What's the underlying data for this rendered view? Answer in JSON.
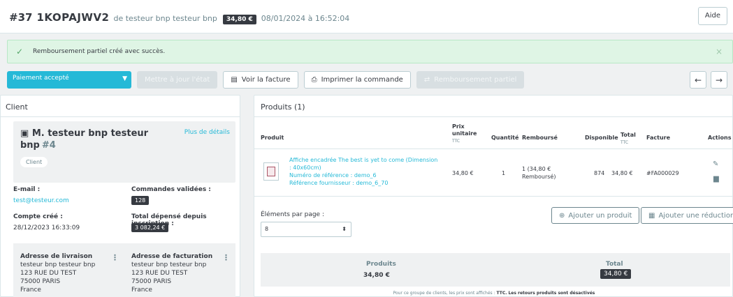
{
  "order": {
    "number": "#37",
    "reference": "1KOPAJWV2",
    "by": "de testeur bnp testeur bnp",
    "total_badge": "34,80 €",
    "date": "08/01/2024 à 16:52:04"
  },
  "header": {
    "help_label": "Aide"
  },
  "alert": {
    "message": "Remboursement partiel créé avec succès."
  },
  "toolbar": {
    "status_value": "Paiement accepté",
    "update_state_label": "Mettre à jour l'état",
    "view_invoice_label": "Voir la facture",
    "print_order_label": "Imprimer la commande",
    "partial_refund_label": "Remboursement partiel"
  },
  "client": {
    "panel_title": "Client",
    "name": "M. testeur bnp testeur bnp",
    "id": "#4",
    "more_details": "Plus de détails",
    "group_tag": "Client",
    "email_label": "E-mail :",
    "email_value": "test@testeur.com",
    "validated_orders_label": "Commandes validées :",
    "validated_orders_value": "128",
    "account_created_label": "Compte créé :",
    "account_created_value": "28/12/2023 16:33:09",
    "total_spent_label": "Total dépensé depuis inscription :",
    "total_spent_value": "3 082,24 €",
    "shipping_address": {
      "title": "Adresse de livraison",
      "line1": "testeur bnp testeur bnp",
      "line2": "123 RUE DU TEST",
      "line3": "75000 PARIS",
      "line4": "France"
    },
    "invoice_address": {
      "title": "Adresse de facturation",
      "line1": "testeur bnp testeur bnp",
      "line2": "123 RUE DU TEST",
      "line3": "75000 PARIS",
      "line4": "France"
    }
  },
  "products": {
    "panel_title": "Produits (1)",
    "columns": {
      "product": "Produit",
      "unit_price": "Prix unitaire",
      "unit_price_ttc": "TTC",
      "quantity": "Quantité",
      "refunded": "Remboursé",
      "available": "Disponible",
      "total": "Total",
      "total_ttc": "TTC",
      "invoice": "Facture",
      "actions": "Actions"
    },
    "row": {
      "name": "Affiche encadrée The best is yet to come (Dimension : 40x60cm)",
      "reference": "Numéro de référence : demo_6",
      "supplier_reference": "Référence fournisseur : demo_6_70",
      "unit_price": "34,80 €",
      "quantity": "1",
      "refunded": "1 (34,80 € Remboursé)",
      "available": "874",
      "total": "34,80 €",
      "invoice": "#FA000029"
    },
    "per_page_label": "Éléments par page :",
    "per_page_value": "8",
    "add_product_label": "Ajouter un produit",
    "add_discount_label": "Ajouter une réduction",
    "totals": {
      "products_label": "Produits",
      "products_value": "34,80 €",
      "total_label": "Total",
      "total_value": "34,80 €"
    },
    "note_prefix": "Pour ce groupe de clients, les prix sont affichés :",
    "note_ttc": "TTC.",
    "note_returns": "Les retours produits sont désactivés"
  }
}
